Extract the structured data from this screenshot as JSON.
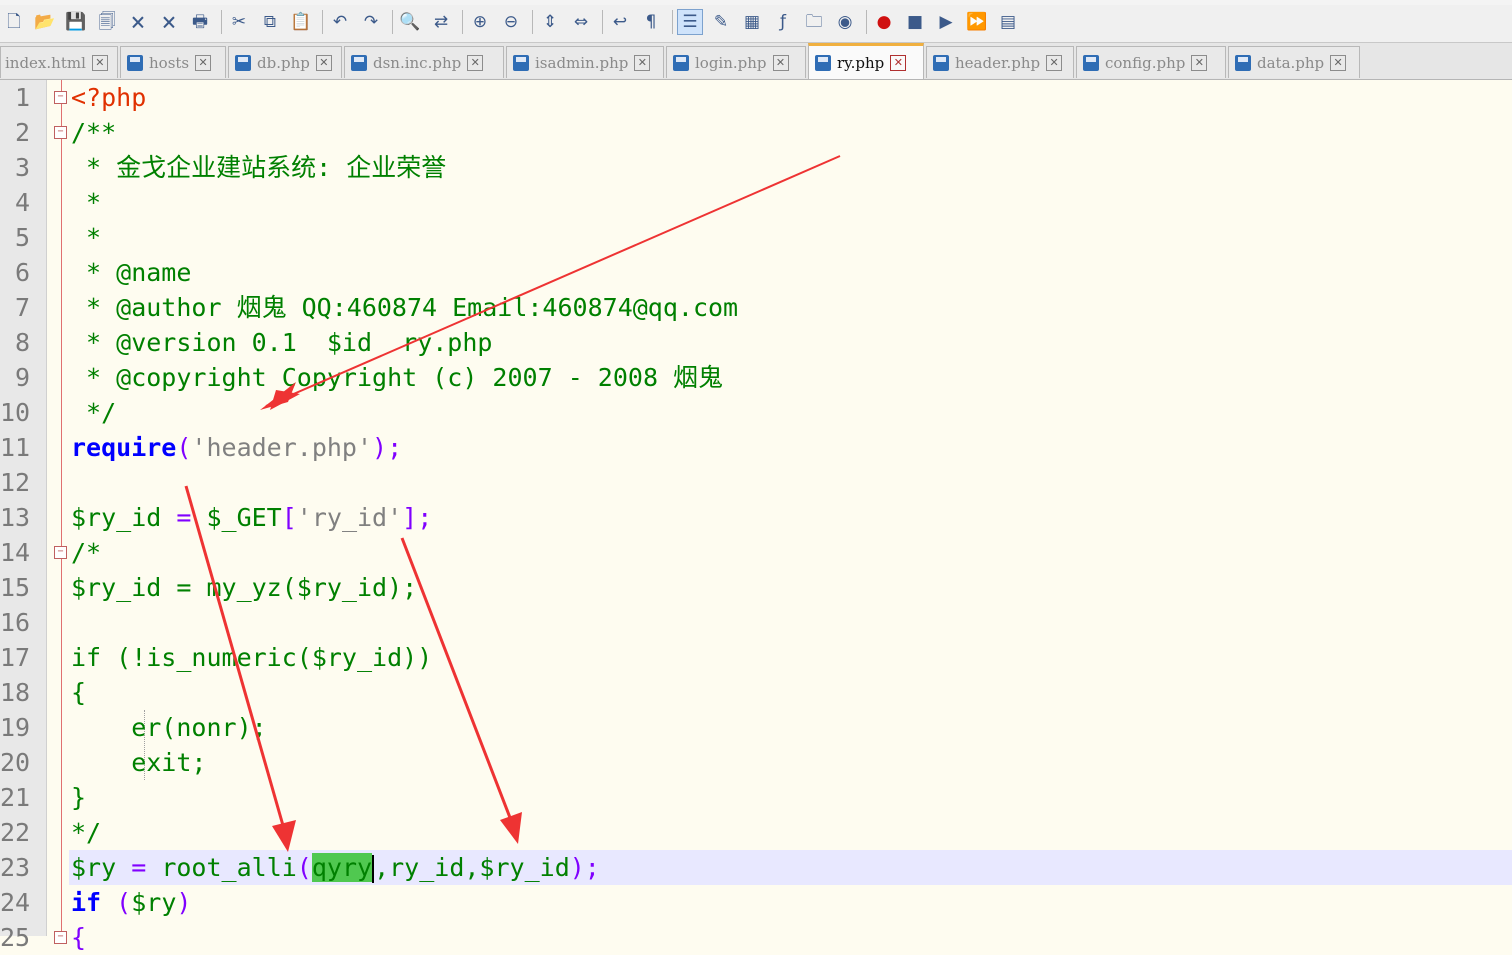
{
  "toolbar": {
    "icons": [
      "new-icon",
      "open-icon",
      "save-icon",
      "save-all-icon",
      "close-icon",
      "close-all-icon",
      "print-icon",
      "cut-icon",
      "copy-icon",
      "paste-icon",
      "undo-icon",
      "redo-icon",
      "find-icon",
      "replace-icon",
      "zoom-in-icon",
      "zoom-out-icon",
      "sync-vertical-icon",
      "sync-horizontal-icon",
      "word-wrap-icon",
      "show-all-chars-icon",
      "indent-guide-icon",
      "user-lang-icon",
      "doc-map-icon",
      "function-list-icon",
      "folder-workspace-icon",
      "monitor-icon",
      "record-macro-icon",
      "stop-record-icon",
      "play-macro-icon",
      "run-macro-multiple-icon",
      "save-macro-icon"
    ]
  },
  "tabs": [
    {
      "label": "index.html",
      "active": false
    },
    {
      "label": "hosts",
      "active": false
    },
    {
      "label": "db.php",
      "active": false
    },
    {
      "label": "dsn.inc.php",
      "active": false
    },
    {
      "label": "isadmin.php",
      "active": false
    },
    {
      "label": "login.php",
      "active": false
    },
    {
      "label": "ry.php",
      "active": true
    },
    {
      "label": "header.php",
      "active": false
    },
    {
      "label": "config.php",
      "active": false
    },
    {
      "label": "data.php",
      "active": false
    }
  ],
  "editor": {
    "line_numbers": [
      "1",
      "2",
      "3",
      "4",
      "5",
      "6",
      "7",
      "8",
      "9",
      "10",
      "11",
      "12",
      "13",
      "14",
      "15",
      "16",
      "17",
      "18",
      "19",
      "20",
      "21",
      "22",
      "23",
      "24",
      "25"
    ],
    "current_line": 23,
    "lines": {
      "l1": "<?php",
      "l2": "/**",
      "l3": " * 金戈企业建站系统: 企业荣誉",
      "l4": " *",
      "l5": " *",
      "l6": " * @name",
      "l7": " * @author 烟鬼 QQ:460874 Email:460874@qq.com",
      "l8": " * @version 0.1  $id  ry.php",
      "l9": " * @copyright Copyright (c) 2007 - 2008 烟鬼",
      "l10": " */",
      "l11a": "require",
      "l11b": "(",
      "l11c": "'header.php'",
      "l11d": ");",
      "l13a": "$ry_id ",
      "l13b": "=",
      "l13c": " $_GET",
      "l13d": "[",
      "l13e": "'ry_id'",
      "l13f": "];",
      "l14": "/*",
      "l15": "$ry_id = my_yz($ry_id);",
      "l17": "if (!is_numeric($ry_id))",
      "l18": "{",
      "l19": "    er(nonr);",
      "l20": "    exit;",
      "l21": "}",
      "l22": "*/",
      "l23a": "$ry ",
      "l23b": "=",
      "l23c": " root_alli",
      "l23d": "(",
      "l23e": "qyry",
      "l23f": ",ry_id,$ry_id",
      "l23g": ");",
      "l24a": "if",
      "l24b": " (",
      "l24c": "$ry",
      "l24d": ")",
      "l25": "{"
    }
  },
  "colors": {
    "annotation_arrow": "#ee3333",
    "keyword": "#0000ff",
    "comment": "#008000",
    "php_tag": "#e03000",
    "string": "#808080",
    "operator": "#8000ff",
    "highlight": "#50c850"
  }
}
